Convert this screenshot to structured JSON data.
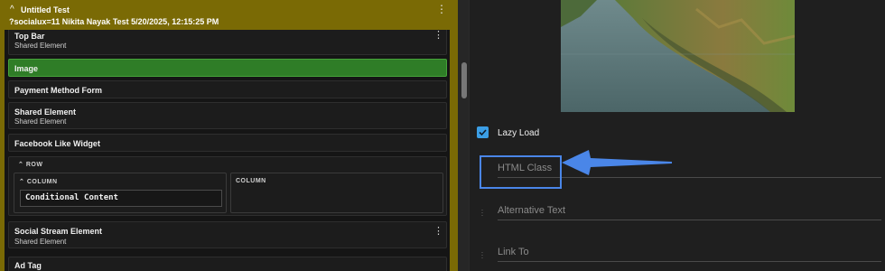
{
  "header": {
    "title": "Untitled Test",
    "subtitle": "?socialux=11 Nikita Nayak Test 5/20/2025, 12:15:25 PM"
  },
  "list": {
    "items": [
      {
        "name": "Top Bar",
        "meta": "Shared Element"
      },
      {
        "name": "Image"
      },
      {
        "name": "Payment Method Form"
      },
      {
        "name": "Shared Element",
        "meta": "Shared Element"
      },
      {
        "name": "Facebook Like Widget"
      },
      {
        "name": "Social Stream Element",
        "meta": "Shared Element"
      },
      {
        "name": "Ad Tag"
      }
    ],
    "row": {
      "label": "ROW",
      "columns": [
        {
          "label": "COLUMN",
          "content": "Conditional Content"
        },
        {
          "label": "COLUMN"
        }
      ]
    }
  },
  "settings": {
    "lazy_load_label": "Lazy Load",
    "lazy_load_checked": true,
    "fields": [
      {
        "placeholder": "HTML Class"
      },
      {
        "placeholder": "Alternative Text"
      },
      {
        "placeholder": "Link To"
      }
    ]
  },
  "colors": {
    "header_bg": "#7a6a05",
    "selected_item": "#2f7d27",
    "checkbox": "#3b9ee5",
    "annotation": "#4a86e8"
  },
  "icons": [
    "chevron-up-icon",
    "more-vert-icon",
    "check-icon",
    "drag-handle-icon",
    "arrow-left-icon"
  ]
}
